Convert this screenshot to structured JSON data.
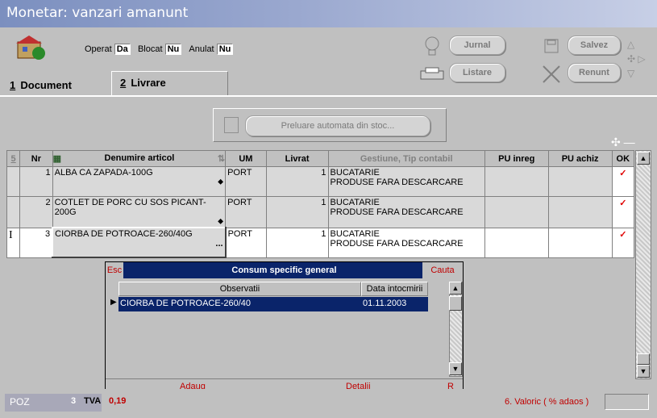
{
  "window": {
    "title": "Monetar: vanzari amanunt"
  },
  "header": {
    "operat_label": "Operat",
    "operat_value": "Da",
    "blocat_label": "Blocat",
    "blocat_value": "Nu",
    "anulat_label": "Anulat",
    "anulat_value": "Nu",
    "buttons": {
      "jurnal": "Jurnal",
      "listare": "Listare",
      "salvez": "Salvez",
      "renunt": "Renunt"
    }
  },
  "tabs": [
    {
      "num": "1",
      "label": "Document"
    },
    {
      "num": "2",
      "label": "Livrare"
    }
  ],
  "preluare_button": "Preluare automata din stoc...",
  "grid": {
    "corner": "5",
    "headers": [
      "Nr",
      "Denumire articol",
      "UM",
      "Livrat",
      "Gestiune, Tip contabil",
      "PU inreg",
      "PU achiz",
      "OK"
    ],
    "rows": [
      {
        "nr": "1",
        "name": "ALBA CA ZAPADA-100G",
        "um": "PORT",
        "livrat": "1",
        "gest1": "BUCATARIE",
        "gest2": "PRODUSE FARA DESCARCARE",
        "pu_inreg": "",
        "pu_achiz": "",
        "ok": "✓"
      },
      {
        "nr": "2",
        "name": "COTLET DE PORC CU SOS PICANT-200G",
        "um": "PORT",
        "livrat": "1",
        "gest1": "BUCATARIE",
        "gest2": "PRODUSE FARA DESCARCARE",
        "pu_inreg": "",
        "pu_achiz": "",
        "ok": "✓"
      },
      {
        "nr": "3",
        "name": "CIORBA DE POTROACE-260/40G",
        "um": "PORT",
        "livrat": "1",
        "gest1": "BUCATARIE",
        "gest2": "PRODUSE FARA DESCARCARE",
        "pu_inreg": "",
        "pu_achiz": "",
        "ok": "✓",
        "marker": "I",
        "ellipsis": "..."
      }
    ]
  },
  "popup": {
    "esc": "Esc",
    "title": "Consum specific general",
    "cauta": "Cauta",
    "col1": "Observatii",
    "col2": "Data intocmirii",
    "row_name": "CIORBA DE POTROACE-260/40",
    "row_date": "01.11.2003",
    "adaug": "Adaug",
    "detalii": "Detalii",
    "r": "R"
  },
  "status": {
    "poz_label": "POZ",
    "poz_value": "3",
    "tva_label": "TVA",
    "tva_value": "0,19",
    "valoric": "6. Valoric ( % adaos )"
  }
}
